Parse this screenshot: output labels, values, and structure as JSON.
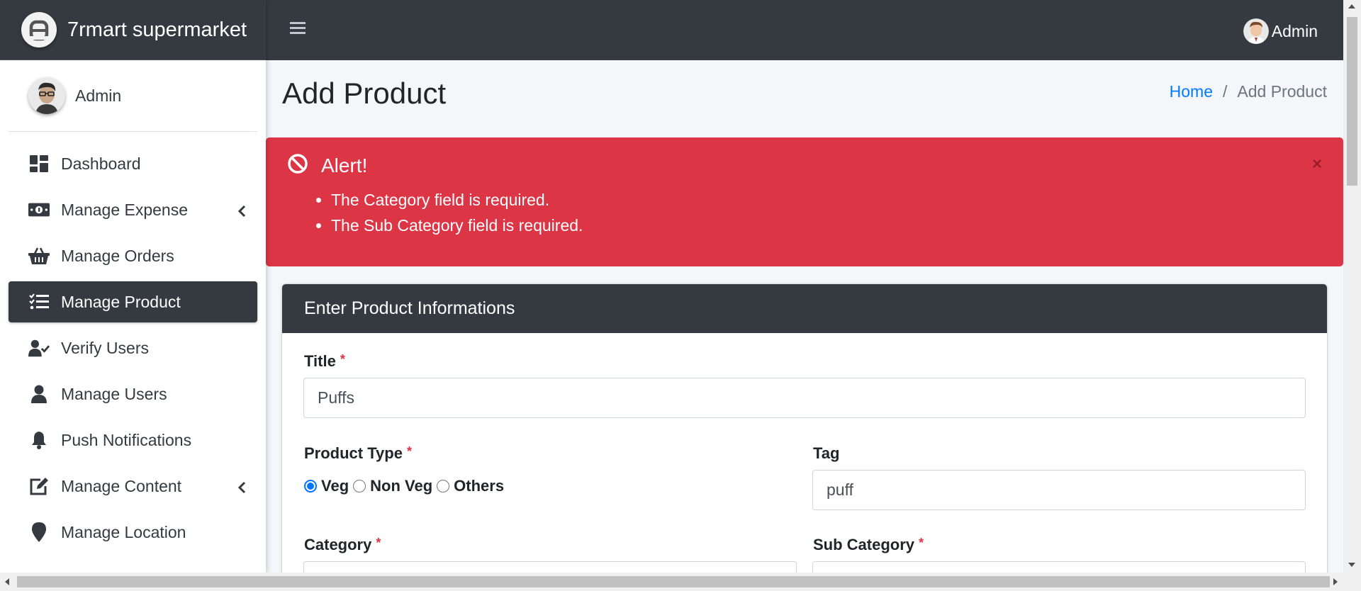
{
  "brand": {
    "name": "7rmart supermarket",
    "logo_icon": "brand-logo-icon"
  },
  "sidebar": {
    "user_name": "Admin",
    "items": [
      {
        "label": "Dashboard",
        "icon": "dashboard-icon"
      },
      {
        "label": "Manage Expense",
        "icon": "money-bill-icon",
        "has_submenu": true
      },
      {
        "label": "Manage Orders",
        "icon": "basket-icon"
      },
      {
        "label": "Manage Product",
        "icon": "tasks-list-icon",
        "active": true
      },
      {
        "label": "Verify Users",
        "icon": "user-check-icon"
      },
      {
        "label": "Manage Users",
        "icon": "user-icon"
      },
      {
        "label": "Push Notifications",
        "icon": "bell-icon"
      },
      {
        "label": "Manage Content",
        "icon": "edit-icon",
        "has_submenu": true
      },
      {
        "label": "Manage Location",
        "icon": "map-marker-icon"
      }
    ]
  },
  "topbar": {
    "user_name": "Admin"
  },
  "page": {
    "title": "Add Product",
    "breadcrumb": {
      "home": "Home",
      "separator": "/",
      "current": "Add Product"
    }
  },
  "alert": {
    "title": "Alert!",
    "close": "×",
    "messages": [
      "The Category field is required.",
      "The Sub Category field is required."
    ],
    "color": "#dc3545"
  },
  "form": {
    "header": "Enter Product Informations",
    "required_mark": "*",
    "title_label": "Title",
    "title_value": "Puffs",
    "product_type_label": "Product Type",
    "product_types": [
      {
        "label": "Veg",
        "checked": true
      },
      {
        "label": "Non Veg",
        "checked": false
      },
      {
        "label": "Others",
        "checked": false
      }
    ],
    "tag_label": "Tag",
    "tag_value": "puff",
    "category_label": "Category",
    "sub_category_label": "Sub Category"
  },
  "colors": {
    "dark": "#343a40",
    "primary": "#007bff",
    "danger": "#dc3545",
    "background": "#f4f6f9"
  }
}
